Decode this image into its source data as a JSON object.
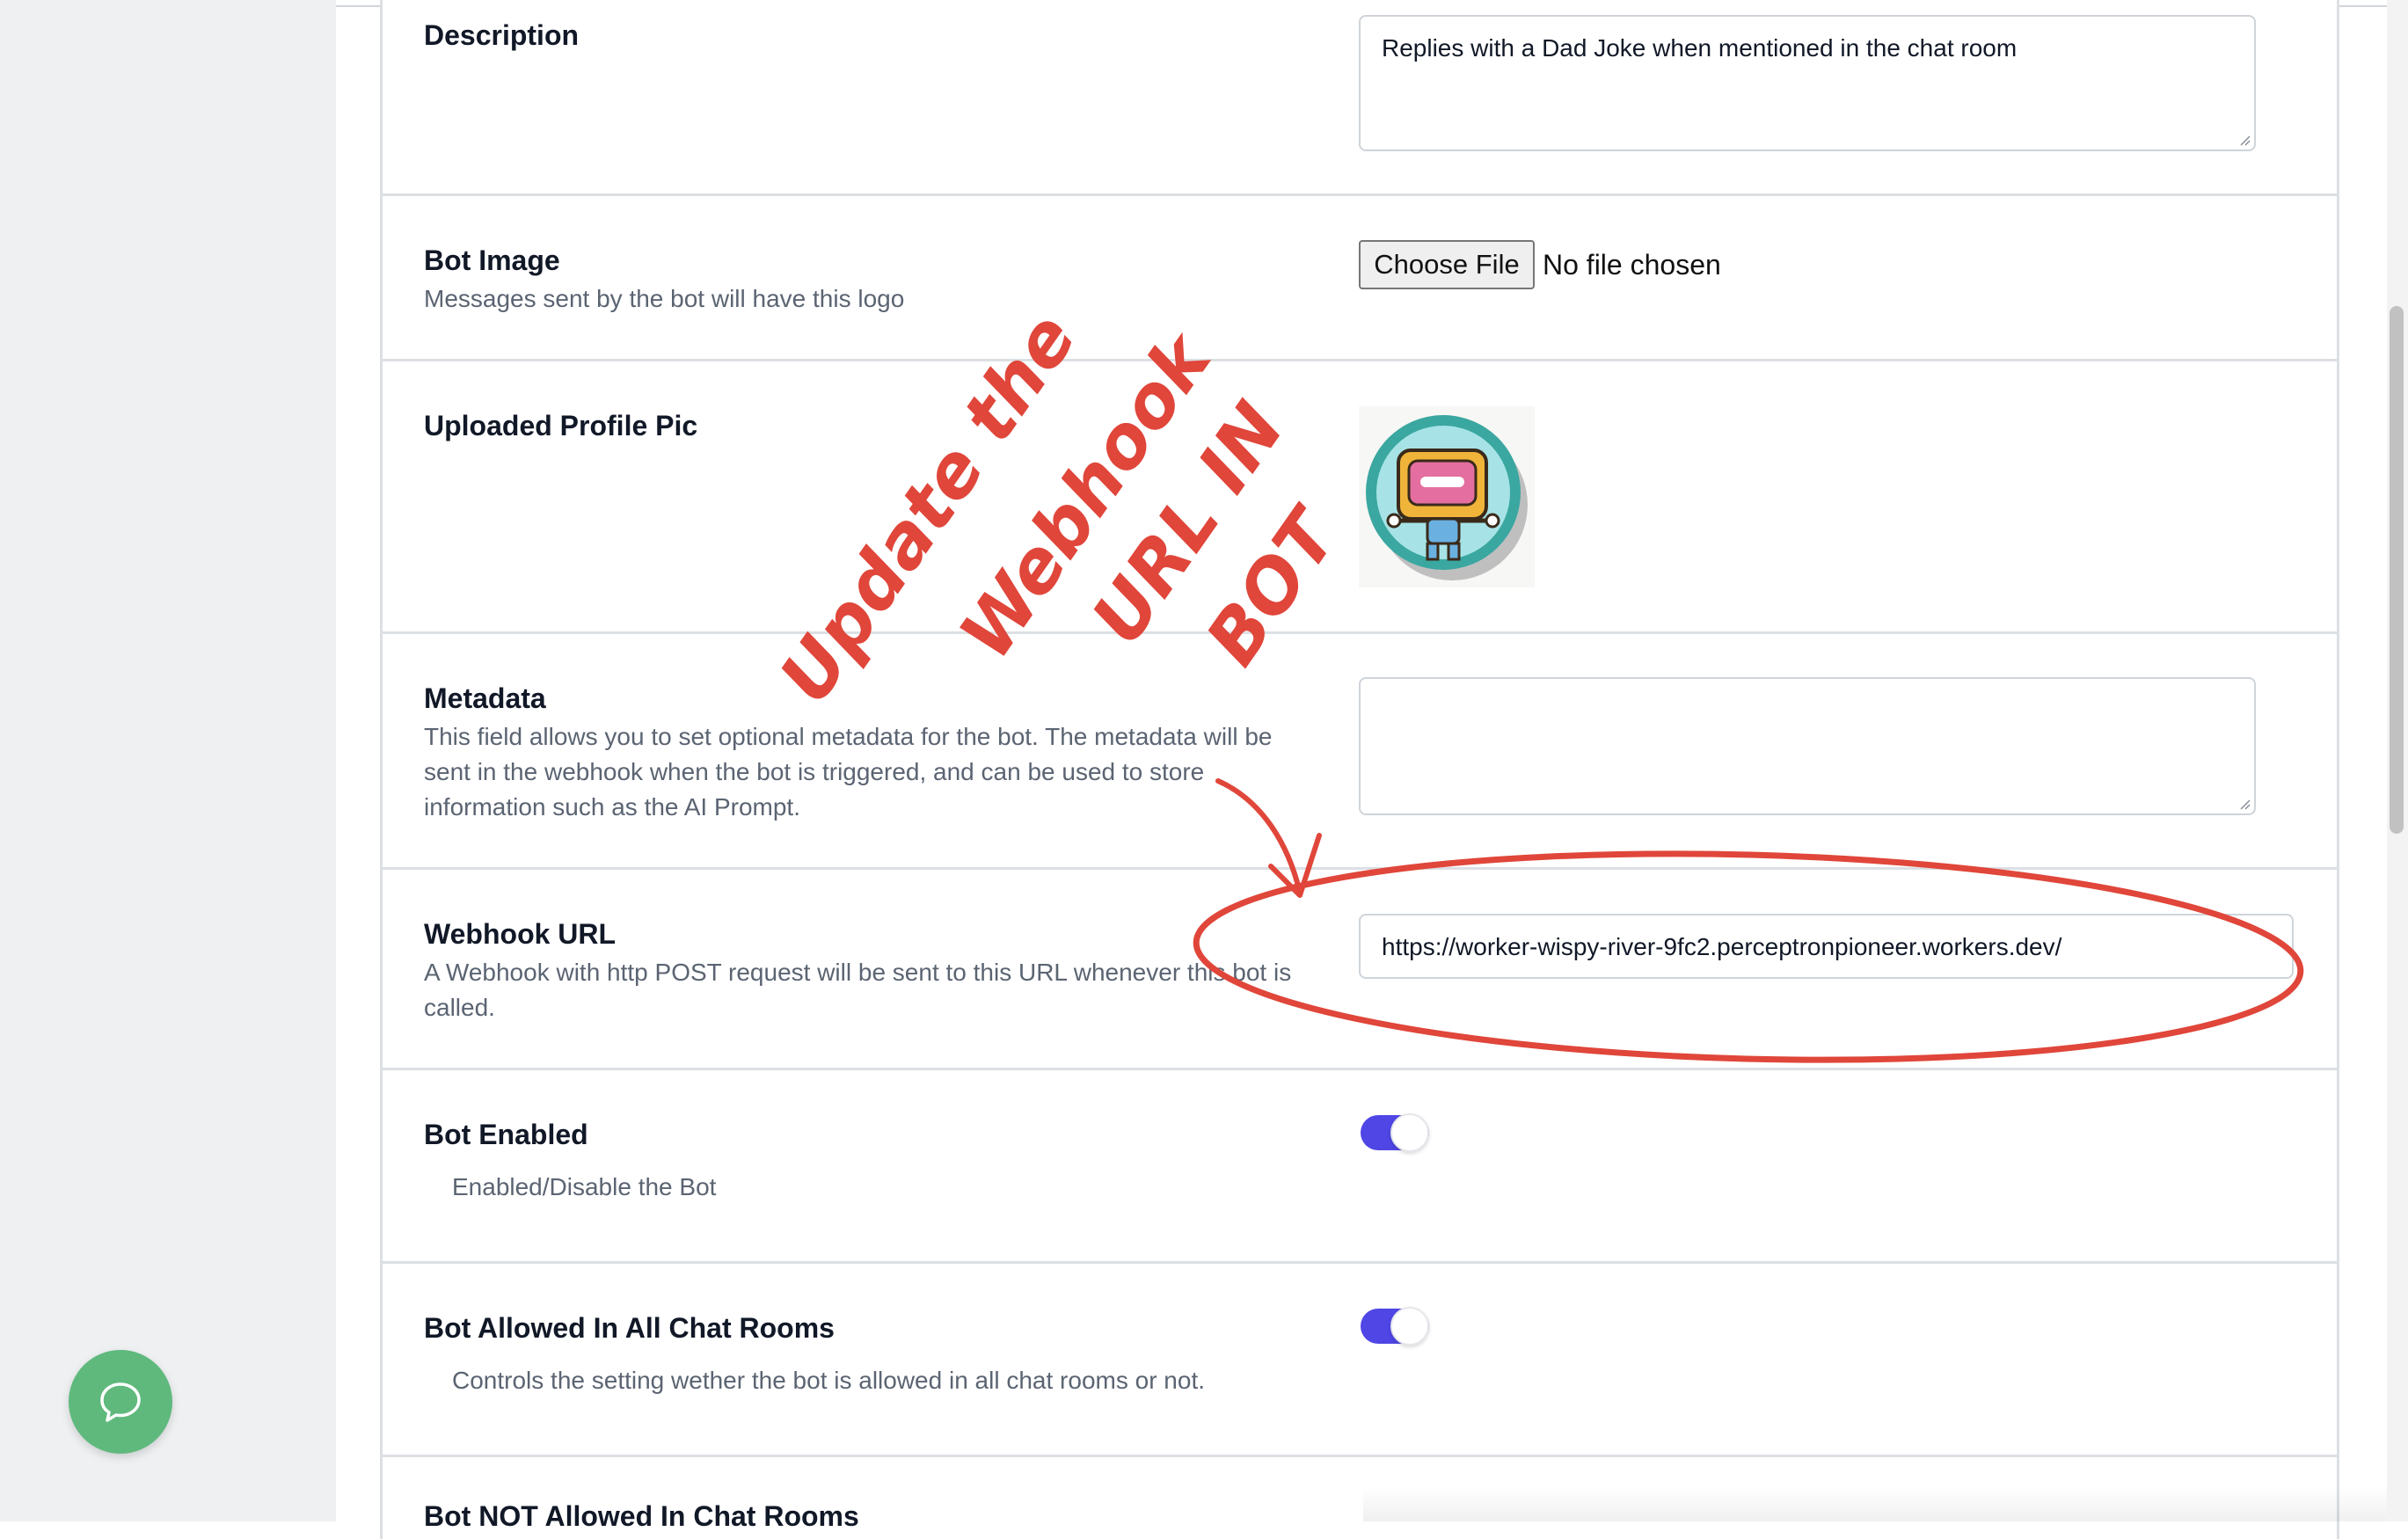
{
  "form": {
    "description": {
      "label": "Description",
      "value": "Replies with a Dad Joke when mentioned in the chat room"
    },
    "bot_image": {
      "label": "Bot Image",
      "help": "Messages sent by the bot will have this logo",
      "button_label": "Choose File",
      "file_status": "No file chosen"
    },
    "uploaded_pic": {
      "label": "Uploaded Profile Pic"
    },
    "metadata": {
      "label": "Metadata",
      "help_line1": "This field allows you to set optional metadata for the bot. The metadata will be",
      "help_line2": "sent in the webhook when the bot is triggered, and can be used to store",
      "help_line3": "information such as the AI Prompt.",
      "value": ""
    },
    "webhook": {
      "label": "Webhook URL",
      "help_line1": "A Webhook with http POST request will be sent to this URL whenever this bot is",
      "help_line2": "called.",
      "value": "https://worker-wispy-river-9fc2.perceptronpioneer.workers.dev/"
    },
    "bot_enabled": {
      "label": "Bot Enabled",
      "help": "Enabled/Disable the Bot",
      "on": true
    },
    "bot_all_rooms": {
      "label": "Bot Allowed In All Chat Rooms",
      "help": "Controls the setting wether the bot is allowed in all chat rooms or not.",
      "on": true
    },
    "bot_not_allowed": {
      "label": "Bot NOT Allowed In Chat Rooms"
    }
  },
  "annotation": {
    "line1": "Update the",
    "line2": "Webhook",
    "line3": "URL IN",
    "line4": "BOT",
    "color": "#e0463a"
  },
  "colors": {
    "toggle_on": "#4f46e5",
    "chat_button": "#5fb97d"
  },
  "icons": {
    "chat": "chat-bubble-icon",
    "avatar": "robot-avatar"
  }
}
